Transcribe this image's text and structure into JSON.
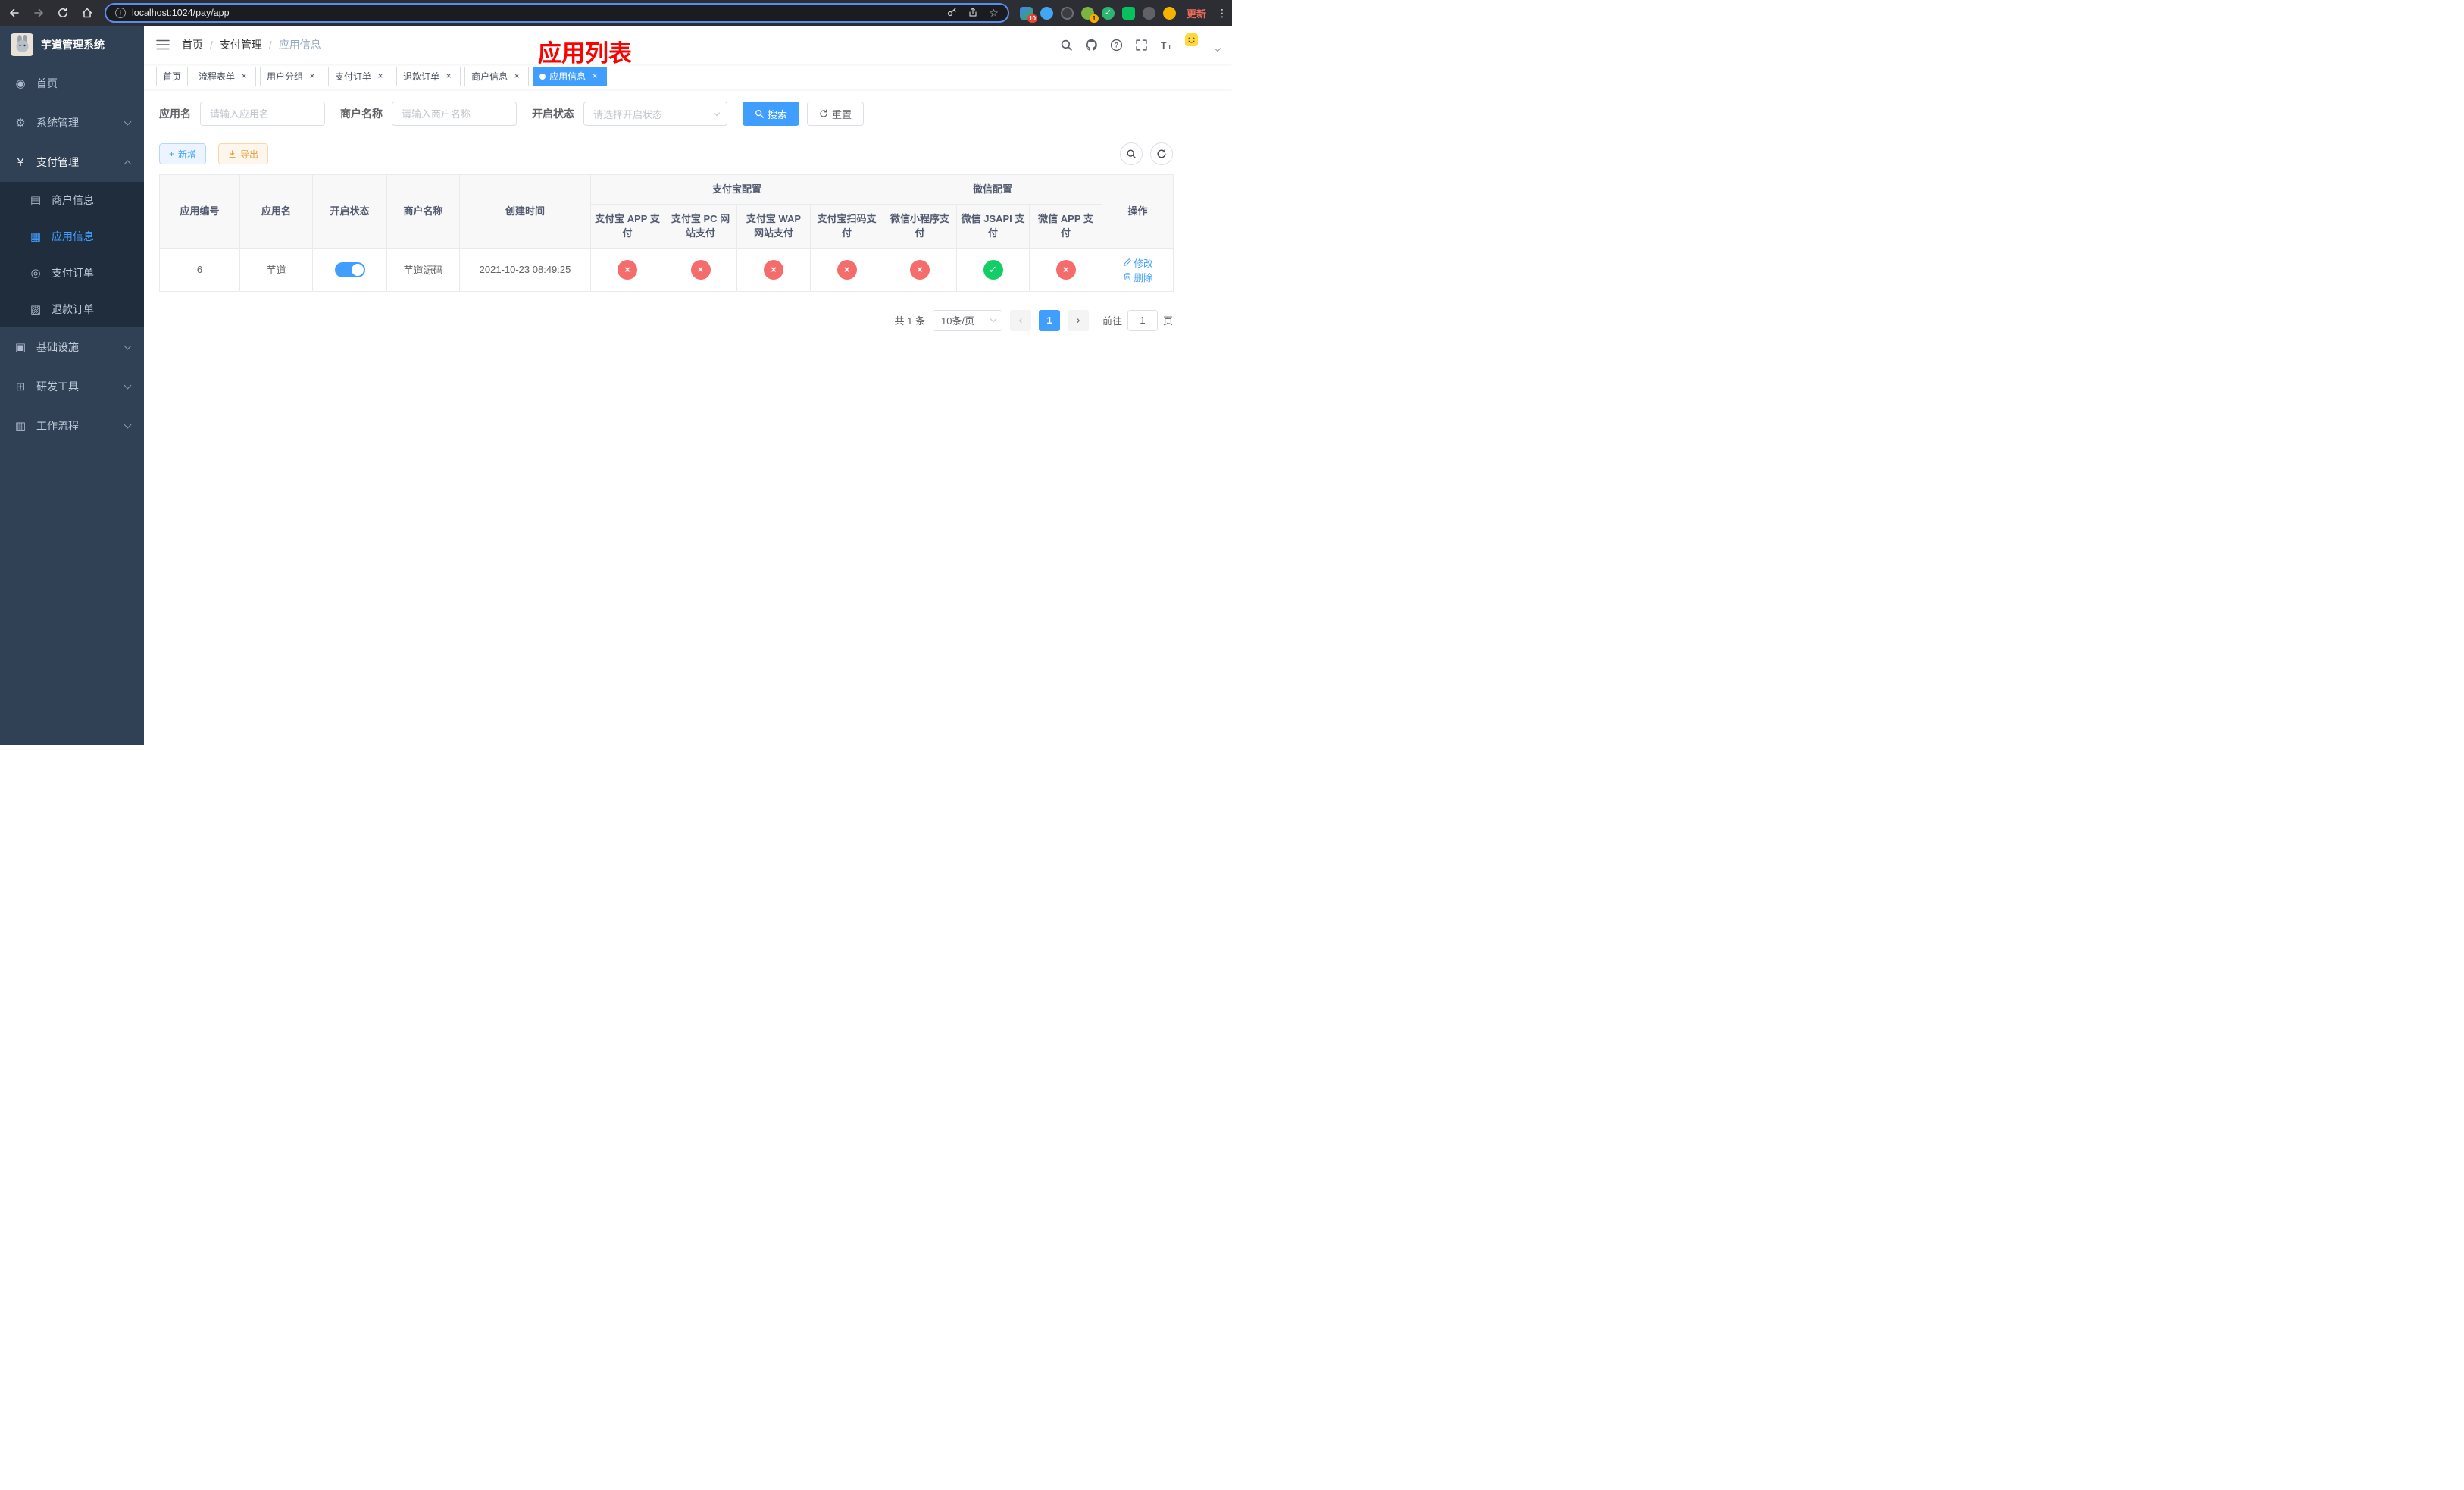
{
  "colors": {
    "accent": "#409EFF",
    "success": "#13ce66",
    "danger": "#f56c6c",
    "warning": "#e6a23c",
    "annotation_red": "#ff0000",
    "sidebar_bg": "#304156",
    "sidebar_sub_bg": "#1f2d3d",
    "chrome_bg": "#2c2e33",
    "update_red": "#f06a5c"
  },
  "browser": {
    "url": "localhost:1024/pay/app",
    "update_label": "更新",
    "extensions_badge": "10",
    "profile_badge": "1"
  },
  "sidebar": {
    "title": "芋道管理系统",
    "items": [
      {
        "label": "首页",
        "icon": "dashboard-icon"
      },
      {
        "label": "系统管理",
        "icon": "gear-icon"
      },
      {
        "label": "支付管理",
        "icon": "yen-icon",
        "expanded": true,
        "children": [
          {
            "label": "商户信息",
            "icon": "merchant-card-icon"
          },
          {
            "label": "应用信息",
            "icon": "app-grid-icon",
            "active": true
          },
          {
            "label": "支付订单",
            "icon": "pay-order-icon"
          },
          {
            "label": "退款订单",
            "icon": "refund-order-icon"
          }
        ]
      },
      {
        "label": "基础设施",
        "icon": "infra-icon"
      },
      {
        "label": "研发工具",
        "icon": "devtools-icon"
      },
      {
        "label": "工作流程",
        "icon": "workflow-icon"
      }
    ]
  },
  "navbar": {
    "breadcrumb": [
      "首页",
      "支付管理",
      "应用信息"
    ],
    "annotation": "应用列表"
  },
  "tabs": [
    {
      "label": "首页"
    },
    {
      "label": "流程表单"
    },
    {
      "label": "用户分组"
    },
    {
      "label": "支付订单"
    },
    {
      "label": "退款订单"
    },
    {
      "label": "商户信息"
    },
    {
      "label": "应用信息",
      "active": true
    }
  ],
  "filters": {
    "app_name_label": "应用名",
    "app_name_placeholder": "请输入应用名",
    "merchant_label": "商户名称",
    "merchant_placeholder": "请输入商户名称",
    "status_label": "开启状态",
    "status_placeholder": "请选择开启状态",
    "search_label": "搜索",
    "reset_label": "重置"
  },
  "toolbar": {
    "add_label": "新增",
    "export_label": "导出"
  },
  "table": {
    "columns": {
      "id": "应用编号",
      "name": "应用名",
      "status": "开启状态",
      "merchant": "商户名称",
      "created": "创建时间",
      "group_alipay": "支付宝配置",
      "group_wechat": "微信配置",
      "alipay_app": "支付宝 APP 支付",
      "alipay_pc": "支付宝 PC 网站支付",
      "alipay_wap": "支付宝 WAP 网站支付",
      "alipay_scan": "支付宝扫码支付",
      "wx_mini": "微信小程序支付",
      "wx_jsapi": "微信 JSAPI 支付",
      "wx_app": "微信 APP 支付",
      "ops": "操作"
    },
    "rows": [
      {
        "id": "6",
        "name": "芋道",
        "enabled": true,
        "merchant": "芋道源码",
        "created": "2021-10-23 08:49:25",
        "statuses": [
          false,
          false,
          false,
          false,
          false,
          true,
          false
        ],
        "edit_label": "修改",
        "delete_label": "删除"
      }
    ]
  },
  "pagination": {
    "total": "共 1 条",
    "page_size": "10条/页",
    "current_page": "1",
    "goto_label": "前往",
    "goto_value": "1",
    "goto_suffix": "页"
  }
}
